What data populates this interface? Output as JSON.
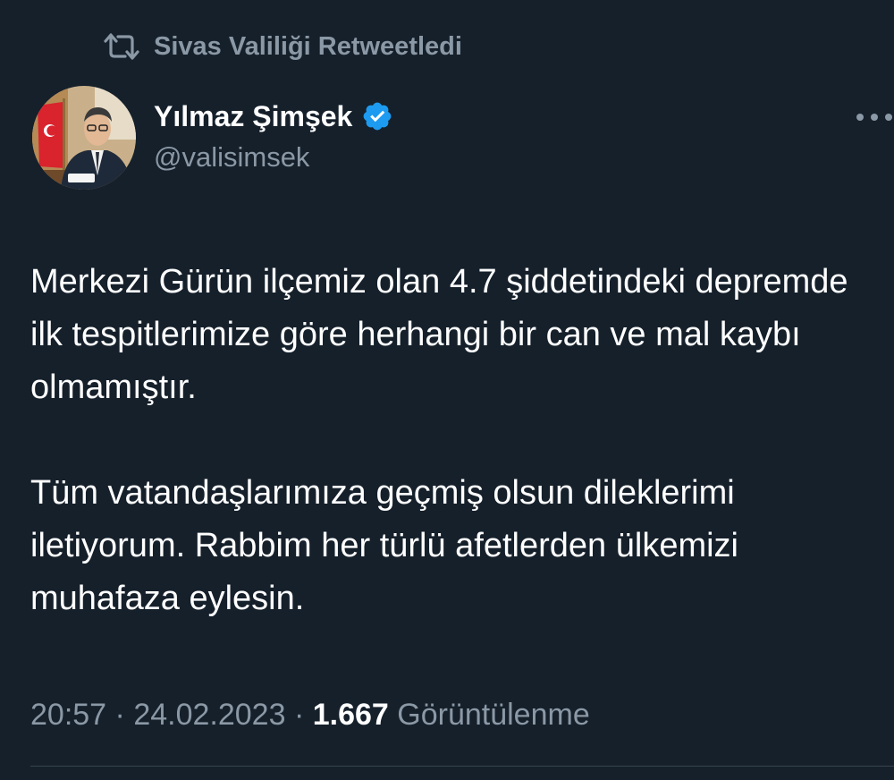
{
  "retweet": {
    "icon": "retweet-icon",
    "text": "Sivas Valiliği Retweetledi"
  },
  "author": {
    "display_name": "Yılmaz Şimşek",
    "handle": "@valisimsek",
    "verified": true,
    "verified_color": "#1d9bf0",
    "avatar": "avatar-photo"
  },
  "more_icon": "more-dots-icon",
  "tweet": {
    "paragraphs": [
      "Merkezi Gürün ilçemiz olan 4.7 şiddetindeki depremde ilk tespitlerimize göre herhangi bir can ve mal kaybı olmamıştır.",
      "Tüm vatandaşlarımıza geçmiş olsun dileklerimi iletiyorum. Rabbim her türlü afetlerden ülkemizi muhafaza eylesin."
    ]
  },
  "meta": {
    "time": "20:57",
    "separator": "·",
    "date": "24.02.2023",
    "views_count": "1.667",
    "views_label": "Görüntülenme"
  },
  "colors": {
    "background": "#15202b",
    "secondary_text": "#8b98a5",
    "primary_text": "#ffffff"
  }
}
